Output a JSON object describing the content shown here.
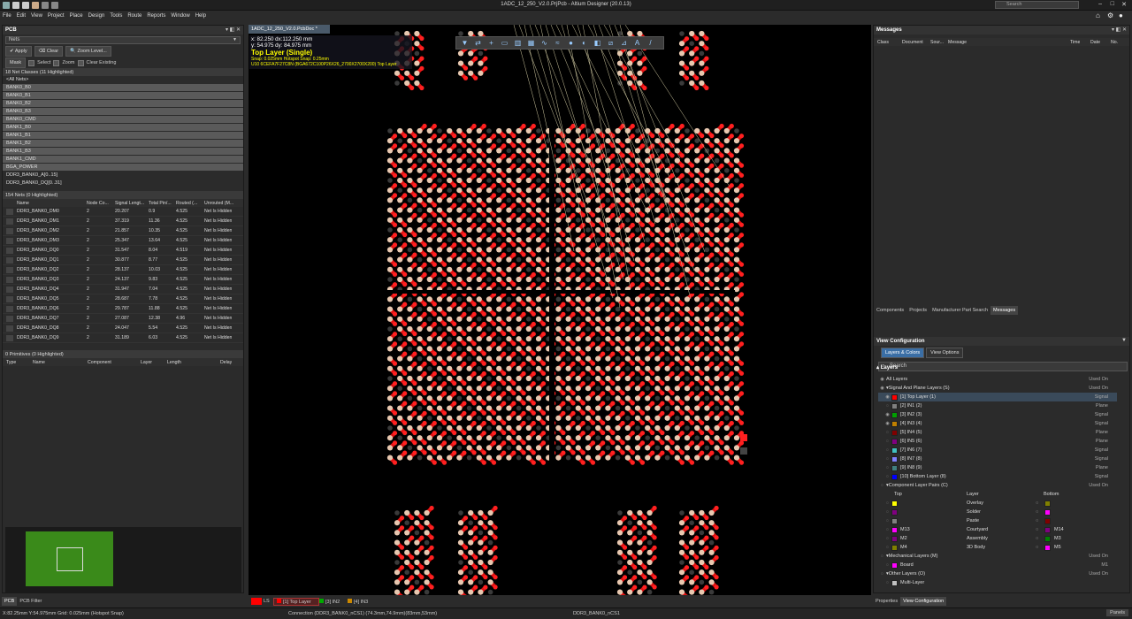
{
  "app": {
    "title": "1ADC_12_250_V2.0.PrjPcb - Altium Designer (20.0.13)",
    "search_placeholder": "Search"
  },
  "menu": [
    "File",
    "Edit",
    "View",
    "Project",
    "Place",
    "Design",
    "Tools",
    "Route",
    "Reports",
    "Window",
    "Help"
  ],
  "left": {
    "panel_title": "PCB",
    "mode": "Nets",
    "apply": "Apply",
    "clear": "Clear",
    "zoom": "Zoom Level...",
    "mask": "Mask",
    "select": "Select",
    "zoom_ck": "Zoom",
    "clear_existing": "Clear Existing",
    "classes_header": "18 Net Classes (11 Highlighted)",
    "classes": [
      "<All Nets>",
      "BANK0_B0",
      "BANK0_B1",
      "BANK0_B2",
      "BANK0_B3",
      "BANK0_CMD",
      "BANK1_B0",
      "BANK1_B1",
      "BANK1_B2",
      "BANK1_B3",
      "BANK1_CMD",
      "BGA_POWER",
      "DDR3_BANK0_A[0..15]",
      "DDR3_BANK0_DQ[0..31]"
    ],
    "nets_header": "154 Nets (0 Highlighted)",
    "net_cols": [
      "Name",
      "Node Co...",
      "Signal Lengt...",
      "Total Pin/...",
      "Routed (...",
      "Unrouted (M..."
    ],
    "nets": [
      [
        "DDR3_BANK0_DM0",
        "2",
        "20.207",
        "0.9",
        "4.525",
        "Net Is Hidden"
      ],
      [
        "DDR3_BANK0_DM1",
        "2",
        "37.319",
        "11.36",
        "4.525",
        "Net Is Hidden"
      ],
      [
        "DDR3_BANK0_DM2",
        "2",
        "21.857",
        "10.35",
        "4.525",
        "Net Is Hidden"
      ],
      [
        "DDR3_BANK0_DM3",
        "2",
        "25.347",
        "13.64",
        "4.525",
        "Net Is Hidden"
      ],
      [
        "DDR3_BANK0_DQ0",
        "2",
        "31.547",
        "8.04",
        "4.519",
        "Net Is Hidden"
      ],
      [
        "DDR3_BANK0_DQ1",
        "2",
        "30.877",
        "8.77",
        "4.525",
        "Net Is Hidden"
      ],
      [
        "DDR3_BANK0_DQ2",
        "2",
        "28.137",
        "10.03",
        "4.525",
        "Net Is Hidden"
      ],
      [
        "DDR3_BANK0_DQ3",
        "2",
        "24.137",
        "9.83",
        "4.525",
        "Net Is Hidden"
      ],
      [
        "DDR3_BANK0_DQ4",
        "2",
        "31.947",
        "7.04",
        "4.525",
        "Net Is Hidden"
      ],
      [
        "DDR3_BANK0_DQ5",
        "2",
        "28.687",
        "7.78",
        "4.525",
        "Net Is Hidden"
      ],
      [
        "DDR3_BANK0_DQ6",
        "2",
        "29.787",
        "11.88",
        "4.525",
        "Net Is Hidden"
      ],
      [
        "DDR3_BANK0_DQ7",
        "2",
        "27.087",
        "12.38",
        "4.96",
        "Net Is Hidden"
      ],
      [
        "DDR3_BANK0_DQ8",
        "2",
        "24.047",
        "5.54",
        "4.525",
        "Net Is Hidden"
      ],
      [
        "DDR3_BANK0_DQ9",
        "2",
        "31.189",
        "6.03",
        "4.525",
        "Net Is Hidden"
      ]
    ],
    "prims_header": "0 Primitives (0 Highlighted)",
    "prim_cols": [
      "Type",
      "Name",
      "Component",
      "Layer",
      "Length",
      "Delay"
    ],
    "tabs": [
      "PCB",
      "PCB Filter"
    ]
  },
  "doc": {
    "tab": "1ADC_12_250_V2.0.PcbDoc *",
    "x": "x: 82.250   dx:112.250 mm",
    "y": "y: 54.975   dy: 84.975 mm",
    "layer": "Top Layer (Single)",
    "snap": "Snap: 0.025mm Hotspot Snap: 0.25mm",
    "comp": "U10 6CEFA7F27C8N (BGA672C100P26X26_2700X2700X200) Top Layer"
  },
  "layers_bar": [
    "LS",
    "[1] Top Layer",
    "[3] IN2",
    "[4] IN3"
  ],
  "right": {
    "messages_title": "Messages",
    "msg_cols": [
      "Class",
      "Document",
      "Sour...",
      "Message",
      "Time",
      "Date",
      "No."
    ],
    "tabs": [
      "Components",
      "Projects",
      "Manufacturer Part Search",
      "Messages"
    ],
    "vc_title": "View Configuration",
    "search": "Search",
    "vc_tabs": [
      "Layers & Colors",
      "View Options"
    ],
    "layers_title": "Layers",
    "all_layers": "All Layers",
    "used_on": "Used On",
    "sig_group": "Signal And Plane Layers (S)",
    "layers": [
      {
        "name": "[1] Top Layer (1)",
        "type": "Signal",
        "color": "#ff0000"
      },
      {
        "name": "[2] IN1 (2)",
        "type": "Plane",
        "color": "#7f7f7f"
      },
      {
        "name": "[3] IN2 (3)",
        "type": "Signal",
        "color": "#00a000"
      },
      {
        "name": "[4] IN3 (4)",
        "type": "Signal",
        "color": "#c08000"
      },
      {
        "name": "[5] IN4 (5)",
        "type": "Plane",
        "color": "#800000"
      },
      {
        "name": "[6] IN5 (6)",
        "type": "Plane",
        "color": "#800080"
      },
      {
        "name": "[7] IN6 (7)",
        "type": "Signal",
        "color": "#40c0c0"
      },
      {
        "name": "[8] IN7 (8)",
        "type": "Signal",
        "color": "#8080ff"
      },
      {
        "name": "[9] IN8 (9)",
        "type": "Plane",
        "color": "#408080"
      },
      {
        "name": "[10] Bottom Layer (8)",
        "type": "Signal",
        "color": "#0000ff"
      }
    ],
    "pair_group": "Component Layer Pairs (C)",
    "pair_cols": [
      "Top",
      "Layer",
      "Bottom"
    ],
    "pairs": [
      {
        "top": "",
        "tc": "#ffff00",
        "layer": "Overlay",
        "bottom": "",
        "bc": "#808000"
      },
      {
        "top": "",
        "tc": "#800080",
        "layer": "Solder",
        "bottom": "",
        "bc": "#ff00ff"
      },
      {
        "top": "",
        "tc": "#808080",
        "layer": "Paste",
        "bottom": "",
        "bc": "#800000"
      },
      {
        "top": "M13",
        "tc": "#ff00ff",
        "layer": "Courtyard",
        "bottom": "M14",
        "bc": "#800080"
      },
      {
        "top": "M2",
        "tc": "#800080",
        "layer": "Assembly",
        "bottom": "M3",
        "bc": "#008000"
      },
      {
        "top": "M4",
        "tc": "#808000",
        "layer": "3D Body",
        "bottom": "M5",
        "bc": "#ff00ff"
      }
    ],
    "mech_group": "Mechanical Layers (M)",
    "board": "Board",
    "board_val": "M1",
    "other_group": "Other Layers (O)",
    "multi": "Multi-Layer",
    "bottom_tabs": [
      "Properties",
      "View Configuration"
    ]
  },
  "status": {
    "left": "X:82.25mm Y:54.975mm   Grid: 0.025mm   (Hotspot Snap)",
    "mid": "Connection (DDR3_BANK0_nCS1) (74.3mm,74.9mm)(83mm,53mm)",
    "net": "DDR3_BANK0_nCS1",
    "panels": "Panels"
  }
}
